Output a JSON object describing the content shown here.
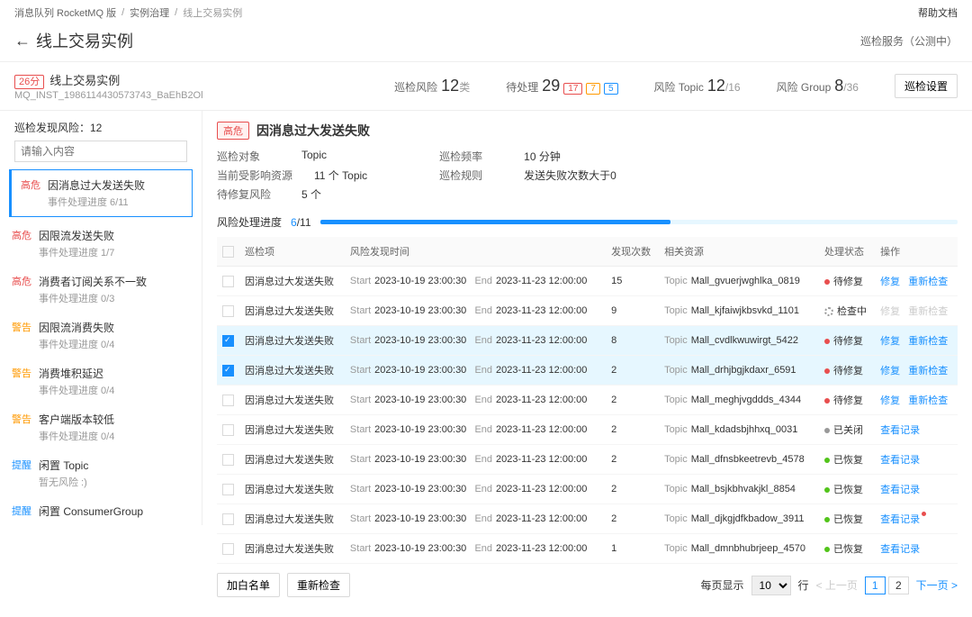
{
  "breadcrumb": {
    "a": "消息队列 RocketMQ 版",
    "b": "实例治理",
    "c": "线上交易实例"
  },
  "help": "帮助文档",
  "page_title": "线上交易实例",
  "service_note": "巡检服务（公测中）",
  "instance": {
    "score": "26分",
    "name": "线上交易实例",
    "id": "MQ_INST_1986114430573743_BaEhB2Ol"
  },
  "stats": {
    "risk_label": "巡检风险",
    "risk_val": "12",
    "risk_unit": "类",
    "pending_label": "待处理",
    "pending_val": "29",
    "p_red": "17",
    "p_org": "7",
    "p_blu": "5",
    "topic_label": "风险 Topic",
    "topic_val": "12",
    "topic_tot": "/16",
    "group_label": "风险 Group",
    "group_val": "8",
    "group_tot": "/36",
    "settings_btn": "巡检设置"
  },
  "sidebar": {
    "head": "巡检发现风险：12",
    "search_ph": "请输入内容",
    "items": [
      {
        "lvl": "高危",
        "lvc": "lv-high",
        "title": "因消息过大发送失败",
        "sub": "事件处理进度 6/11",
        "sel": true
      },
      {
        "lvl": "高危",
        "lvc": "lv-high",
        "title": "因限流发送失败",
        "sub": "事件处理进度 1/7"
      },
      {
        "lvl": "高危",
        "lvc": "lv-high",
        "title": "消费者订阅关系不一致",
        "sub": "事件处理进度 0/3"
      },
      {
        "lvl": "警告",
        "lvc": "lv-warn",
        "title": "因限流消费失败",
        "sub": "事件处理进度 0/4"
      },
      {
        "lvl": "警告",
        "lvc": "lv-warn",
        "title": "消费堆积延迟",
        "sub": "事件处理进度 0/4"
      },
      {
        "lvl": "警告",
        "lvc": "lv-warn",
        "title": "客户端版本较低",
        "sub": "事件处理进度 0/4"
      },
      {
        "lvl": "提醒",
        "lvc": "lv-info",
        "title": "闲置 Topic",
        "sub": "暂无风险 :)"
      },
      {
        "lvl": "提醒",
        "lvc": "lv-info",
        "title": "闲置 ConsumerGroup",
        "sub": ""
      }
    ]
  },
  "detail": {
    "tag": "高危",
    "title": "因消息过大发送失败",
    "meta": [
      [
        {
          "k": "巡检对象",
          "v": "Topic"
        },
        {
          "k": "巡检频率",
          "v": "10 分钟"
        }
      ],
      [
        {
          "k": "当前受影响资源",
          "v": "11 个 Topic"
        },
        {
          "k": "巡检规则",
          "v": "发送失败次数大于0"
        }
      ],
      [
        {
          "k": "待修复风险",
          "v": "5 个"
        }
      ]
    ],
    "prog_label": "风险处理进度",
    "prog_val": "6",
    "prog_tot": "/11",
    "prog_pct": 55
  },
  "table": {
    "cols": [
      "巡检项",
      "风险发现时间",
      "发现次数",
      "相关资源",
      "处理状态",
      "操作"
    ],
    "actions": {
      "fix": "修复",
      "recheck": "重新检查",
      "view": "查看记录"
    },
    "status": {
      "wait": "待修复",
      "checking": "检查中",
      "closed": "已关闭",
      "restored": "已恢复"
    },
    "time_lbl": {
      "start": "Start",
      "end": "End"
    },
    "res_lbl": "Topic",
    "rows": [
      {
        "chk": false,
        "item": "因消息过大发送失败",
        "start": "2023-10-19 23:00:30",
        "end": "2023-11-23 12:00:00",
        "cnt": "15",
        "res": "Mall_gvuerjwghlka_0819",
        "status": "wait",
        "ops": [
          "fix",
          "recheck"
        ]
      },
      {
        "chk": false,
        "item": "因消息过大发送失败",
        "start": "2023-10-19 23:00:30",
        "end": "2023-11-23 12:00:00",
        "cnt": "9",
        "res": "Mall_kjfaiwjkbsvkd_1101",
        "status": "checking",
        "ops": [
          "fix",
          "recheck"
        ],
        "dis": true
      },
      {
        "chk": true,
        "hl": true,
        "item": "因消息过大发送失败",
        "start": "2023-10-19 23:00:30",
        "end": "2023-11-23 12:00:00",
        "cnt": "8",
        "res": "Mall_cvdlkwuwirgt_5422",
        "status": "wait",
        "ops": [
          "fix",
          "recheck"
        ]
      },
      {
        "chk": true,
        "hl": true,
        "item": "因消息过大发送失败",
        "start": "2023-10-19 23:00:30",
        "end": "2023-11-23 12:00:00",
        "cnt": "2",
        "res": "Mall_drhjbgjkdaxr_6591",
        "status": "wait",
        "ops": [
          "fix",
          "recheck"
        ]
      },
      {
        "chk": false,
        "item": "因消息过大发送失败",
        "start": "2023-10-19 23:00:30",
        "end": "2023-11-23 12:00:00",
        "cnt": "2",
        "res": "Mall_meghjvgddds_4344",
        "status": "wait",
        "ops": [
          "fix",
          "recheck"
        ]
      },
      {
        "chk": false,
        "item": "因消息过大发送失败",
        "start": "2023-10-19 23:00:30",
        "end": "2023-11-23 12:00:00",
        "cnt": "2",
        "res": "Mall_kdadsbjhhxq_0031",
        "status": "closed",
        "ops": [
          "view"
        ]
      },
      {
        "chk": false,
        "item": "因消息过大发送失败",
        "start": "2023-10-19 23:00:30",
        "end": "2023-11-23 12:00:00",
        "cnt": "2",
        "res": "Mall_dfnsbkeetrevb_4578",
        "status": "restored",
        "ops": [
          "view"
        ]
      },
      {
        "chk": false,
        "item": "因消息过大发送失败",
        "start": "2023-10-19 23:00:30",
        "end": "2023-11-23 12:00:00",
        "cnt": "2",
        "res": "Mall_bsjkbhvakjkl_8854",
        "status": "restored",
        "ops": [
          "view"
        ]
      },
      {
        "chk": false,
        "item": "因消息过大发送失败",
        "start": "2023-10-19 23:00:30",
        "end": "2023-11-23 12:00:00",
        "cnt": "2",
        "res": "Mall_djkgjdfkbadow_3911",
        "status": "restored",
        "ops": [
          "view"
        ],
        "viewdot": true
      },
      {
        "chk": false,
        "item": "因消息过大发送失败",
        "start": "2023-10-19 23:00:30",
        "end": "2023-11-23 12:00:00",
        "cnt": "1",
        "res": "Mall_dmnbhubrjeep_4570",
        "status": "restored",
        "ops": [
          "view"
        ]
      }
    ]
  },
  "pager": {
    "whitelist": "加白名单",
    "recheck": "重新检查",
    "per_label": "每页显示",
    "per_val": "10",
    "row_unit": "行",
    "prev": "上一页",
    "next": "下一页",
    "pages": [
      "1",
      "2"
    ]
  }
}
